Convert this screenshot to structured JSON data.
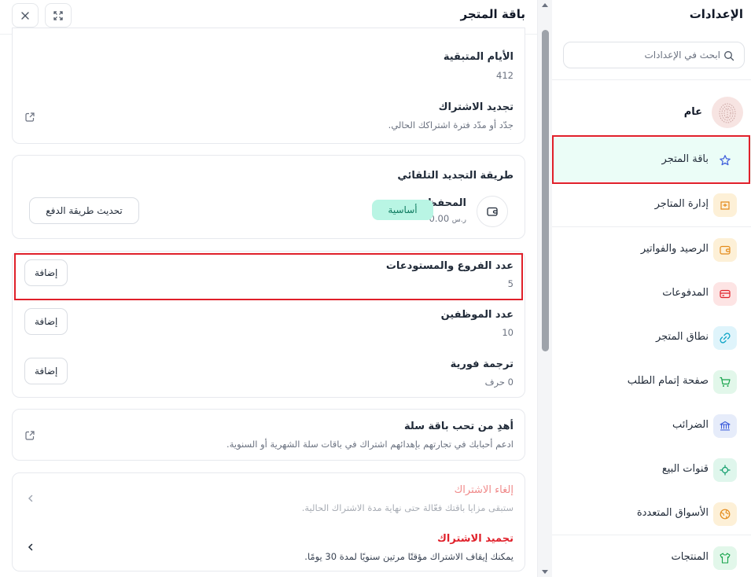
{
  "header": {
    "title": "باقة المتجر",
    "close_icon": "close-icon",
    "expand_icon": "expand-icon"
  },
  "subscription": {
    "remaining_days_label": "الأيام المتبقية",
    "remaining_days_value": "412",
    "renew_title": "تجديد الاشتراك",
    "renew_sub": "جدّد أو مدّد فترة اشتراكك الحالي."
  },
  "auto_renewal": {
    "title": "طريقة التجديد التلقائي",
    "wallet_label": "المحفظة",
    "wallet_balance": "0.00",
    "currency_symbol": "ر.س",
    "badge": "أساسية",
    "update_button": "تحديث طريقة الدفع"
  },
  "addons": [
    {
      "title": "عدد الفروع والمستودعات",
      "value": "5",
      "button": "إضافة"
    },
    {
      "title": "عدد الموظفين",
      "value": "10",
      "button": "إضافة"
    },
    {
      "title": "ترجمة فورية",
      "value": "0 حرف",
      "button": "إضافة"
    }
  ],
  "gift": {
    "title": "أهدِ من تحب باقة سلة",
    "sub": "ادعم أحبابك في تجارتهم بإهدائهم اشتراك في باقات سلة الشهرية أو السنوية."
  },
  "cancel": {
    "title": "إلغاء الاشتراك",
    "sub": "ستبقى مزايا باقتك فعّالة حتى نهاية مدة الاشتراك الحالية."
  },
  "freeze": {
    "title": "تجميد الاشتراك",
    "sub": "يمكنك إيقاف الاشتراك مؤقتًا مرتين سنويًا لمدة 30 يومًا."
  },
  "sidebar": {
    "title": "الإعدادات",
    "search_placeholder": "ابحث في الإعدادات",
    "general_label": "عام",
    "items": [
      {
        "label": "باقة المتجر",
        "icon": "star-icon",
        "color": "#e8f7f2"
      },
      {
        "label": "إدارة المتاجر",
        "icon": "store-icon",
        "color": "#fdf0d7"
      },
      {
        "label": "الرصيد والفواتير",
        "icon": "wallet-icon",
        "color": "#fdf0d7"
      },
      {
        "label": "المدفوعات",
        "icon": "card-icon",
        "color": "#fde4e4"
      },
      {
        "label": "نطاق المتجر",
        "icon": "link-icon",
        "color": "#dff4fb"
      },
      {
        "label": "صفحة إتمام الطلب",
        "icon": "cart-icon",
        "color": "#e2f7ea"
      },
      {
        "label": "الضرائب",
        "icon": "bank-icon",
        "color": "#e6ecfa"
      },
      {
        "label": "قنوات البيع",
        "icon": "channels-icon",
        "color": "#dff6ec"
      },
      {
        "label": "الأسواق المتعددة",
        "icon": "globe-icon",
        "color": "#fdf0d7"
      },
      {
        "label": "المنتجات",
        "icon": "shirt-icon",
        "color": "#e2f7ea"
      }
    ]
  },
  "colors": {
    "accent_green": "#b9f5e4",
    "highlight_red": "#e0202a",
    "active_bg": "#ebfdf7",
    "muted_red_text": "#f08a8a",
    "red_text": "#e0202a"
  }
}
